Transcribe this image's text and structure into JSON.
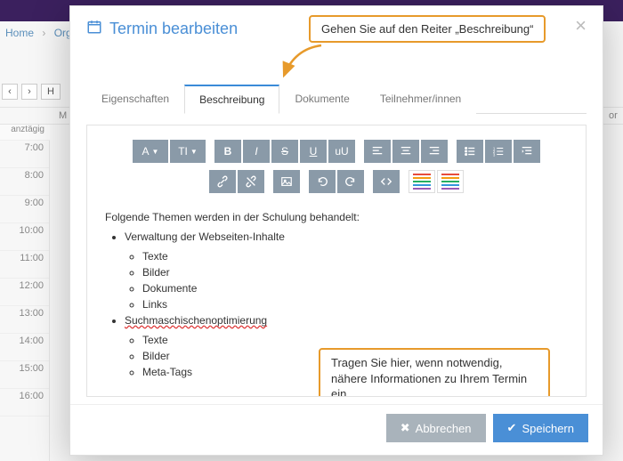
{
  "breadcrumb": {
    "home": "Home",
    "item2": "Organ"
  },
  "calendar": {
    "allday": "anztägig",
    "dayhead_left": "M",
    "dayhead_right": "or",
    "hours": [
      "7:00",
      "8:00",
      "9:00",
      "10:00",
      "11:00",
      "12:00",
      "13:00",
      "14:00",
      "15:00",
      "16:00"
    ],
    "today_btn": "H"
  },
  "modal": {
    "title": "Termin bearbeiten",
    "tabs": {
      "props": "Eigenschaften",
      "desc": "Beschreibung",
      "docs": "Dokumente",
      "attendees": "Teilnehmer/innen"
    },
    "callout_top": "Gehen Sie auf den Reiter „Beschreibung“",
    "callout_mid": "Tragen Sie hier, wenn notwendig, nähere Informationen zu Ihrem Termin ein",
    "toolbar": {
      "font": "A",
      "titleformat": "TI",
      "bold": "B",
      "italic": "I",
      "strike": "S",
      "underline": "U",
      "uu": "uU"
    },
    "editor": {
      "intro": "Folgende Themen werden in der Schulung behandelt:",
      "items": [
        {
          "label": "Verwaltung der Webseiten-Inhalte",
          "children": [
            "Texte",
            "Bilder",
            "Dokumente",
            "Links"
          ]
        },
        {
          "label": "Suchmaschischenoptimierung",
          "spellerr": true,
          "children": [
            "Texte",
            "Bilder",
            "Meta-Tags"
          ]
        }
      ]
    },
    "buttons": {
      "cancel": "Abbrechen",
      "save": "Speichern"
    }
  }
}
